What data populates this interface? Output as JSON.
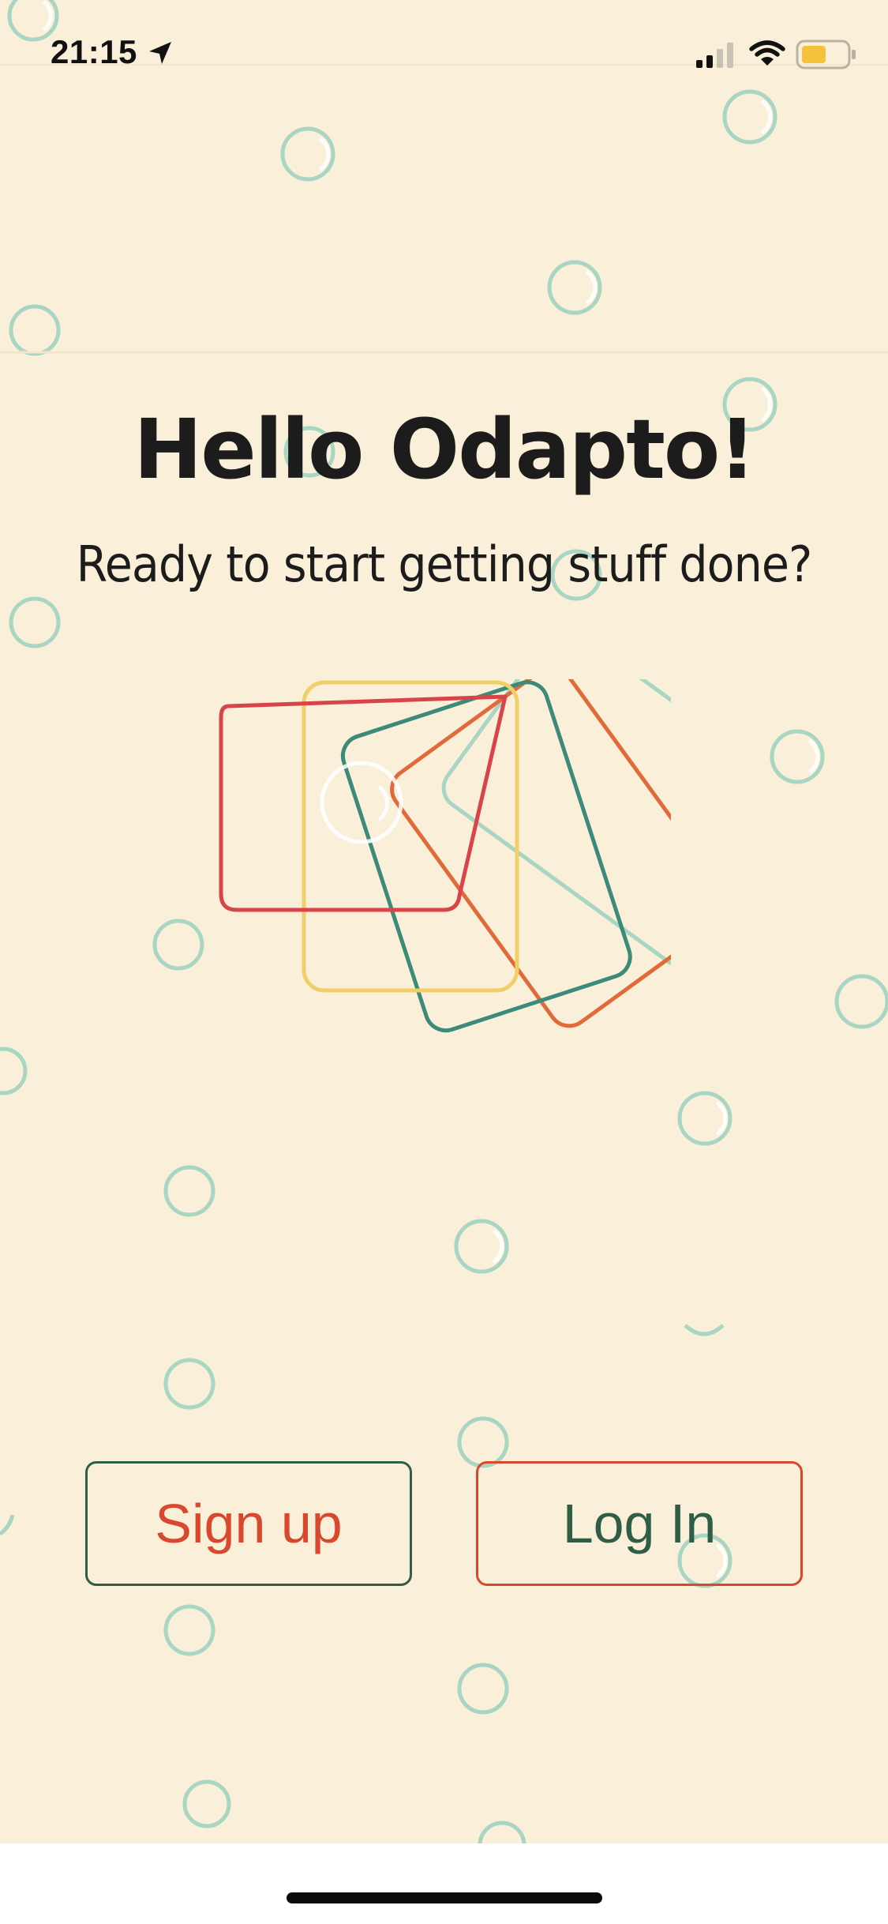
{
  "status_bar": {
    "time": "21:15",
    "location_icon": "location-arrow-icon",
    "signal_icon": "cellular-signal-icon",
    "wifi_icon": "wifi-icon",
    "battery_icon": "battery-icon",
    "battery_color": "#f5c33b"
  },
  "welcome": {
    "title": "Hello Odapto!",
    "subtitle": "Ready to start getting stuff done?"
  },
  "logo": {
    "icon": "fanned-cards-logo",
    "card_colors": [
      "#d9434a",
      "#f0cf6b",
      "#3c8a78",
      "#e06a3a",
      "#a9d5c3"
    ]
  },
  "actions": {
    "signup_label": "Sign up",
    "login_label": "Log In"
  },
  "colors": {
    "background": "#faf0d9",
    "bubble": "#a9d5c3",
    "accent_red": "#d8472e",
    "accent_green": "#2f5d45"
  }
}
